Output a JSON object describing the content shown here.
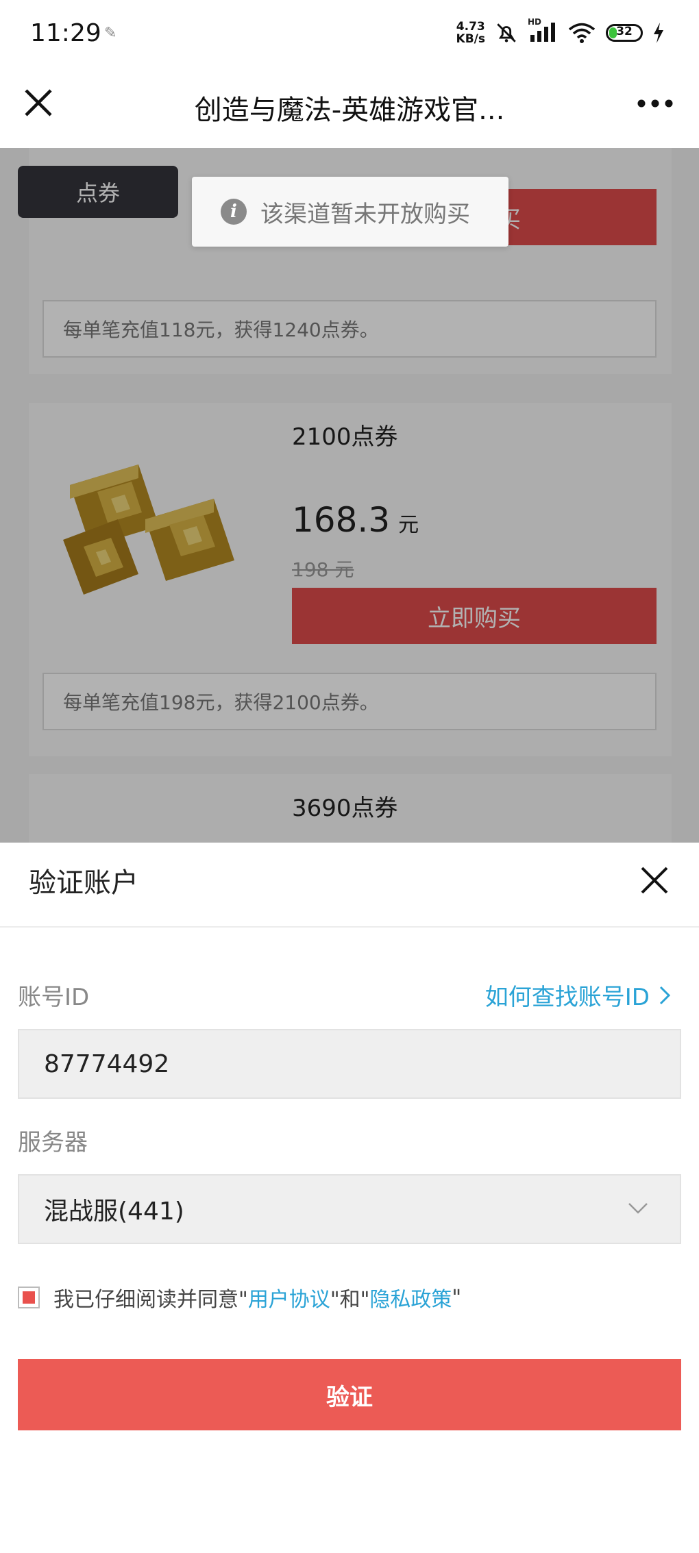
{
  "status_bar": {
    "time": "11:29",
    "net_speed_value": "4.73",
    "net_speed_unit": "KB/s",
    "signal_label": "HD",
    "battery": "32",
    "battery_level_percent": 32
  },
  "title_bar": {
    "title": "创造与魔法-英雄游戏官..."
  },
  "store": {
    "active_tab": "点券",
    "toast": "该渠道暂未开放购买",
    "buy_label": "立即购买",
    "items": [
      {
        "desc": "每单笔充值118元，获得1240点券。"
      },
      {
        "name": "2100点券",
        "price": "168.3",
        "price_unit": "元",
        "old_price": "198 元",
        "desc": "每单笔充值198元，获得2100点券。"
      },
      {
        "name": "3690点券"
      }
    ]
  },
  "sheet": {
    "title": "验证账户",
    "account_label": "账号ID",
    "help_link": "如何查找账号ID",
    "account_value": "87774492",
    "server_label": "服务器",
    "server_value": "混战服(441)",
    "agree_prefix": "我已仔细阅读并同意\"",
    "user_agreement": "用户协议",
    "agree_middle": "\"和\"",
    "privacy_policy": "隐私政策",
    "agree_suffix": "\"",
    "verify_button": "验证"
  },
  "colors": {
    "accent_red": "#ec5b55",
    "buy_red": "#df4b4b",
    "link_blue": "#2aa3d6"
  }
}
